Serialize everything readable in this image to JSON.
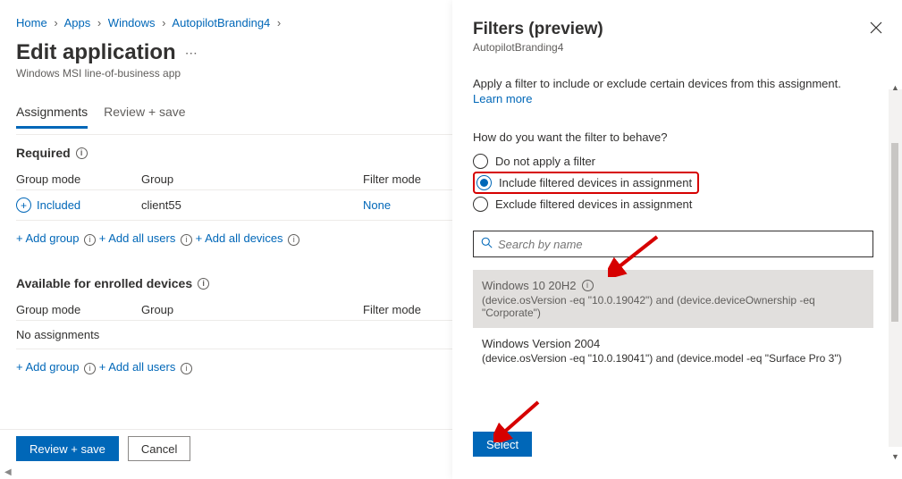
{
  "breadcrumb": [
    "Home",
    "Apps",
    "Windows",
    "AutopilotBranding4"
  ],
  "page": {
    "title": "Edit application",
    "subtitle": "Windows MSI line-of-business app"
  },
  "tabs": [
    {
      "label": "Assignments",
      "active": true
    },
    {
      "label": "Review + save",
      "active": false
    }
  ],
  "required": {
    "heading": "Required",
    "cols": {
      "mode": "Group mode",
      "group": "Group",
      "filter": "Filter mode"
    },
    "row": {
      "mode": "Included",
      "group": "client55",
      "filter": "None"
    },
    "actions": {
      "add_group": "+ Add group",
      "add_users": "+ Add all users",
      "add_devices": "+ Add all devices"
    }
  },
  "available": {
    "heading": "Available for enrolled devices",
    "cols": {
      "mode": "Group mode",
      "group": "Group",
      "filter": "Filter mode"
    },
    "empty": "No assignments",
    "actions": {
      "add_group": "+ Add group",
      "add_users": "+ Add all users"
    }
  },
  "footer": {
    "primary": "Review + save",
    "secondary": "Cancel"
  },
  "panel": {
    "title": "Filters (preview)",
    "subtitle": "AutopilotBranding4",
    "description": "Apply a filter to include or exclude certain devices from this assignment.",
    "learn": "Learn more",
    "question": "How do you want the filter to behave?",
    "radios": {
      "none": "Do not apply a filter",
      "include": "Include filtered devices in assignment",
      "exclude": "Exclude filtered devices in assignment"
    },
    "search_placeholder": "Search by name",
    "filters": [
      {
        "name": "Windows 10 20H2",
        "rule": "(device.osVersion -eq \"10.0.19042\") and (device.deviceOwnership -eq \"Corporate\")",
        "selected": true
      },
      {
        "name": "Windows Version 2004",
        "rule": "(device.osVersion -eq \"10.0.19041\") and (device.model -eq \"Surface Pro 3\")",
        "selected": false
      }
    ],
    "select_button": "Select"
  }
}
